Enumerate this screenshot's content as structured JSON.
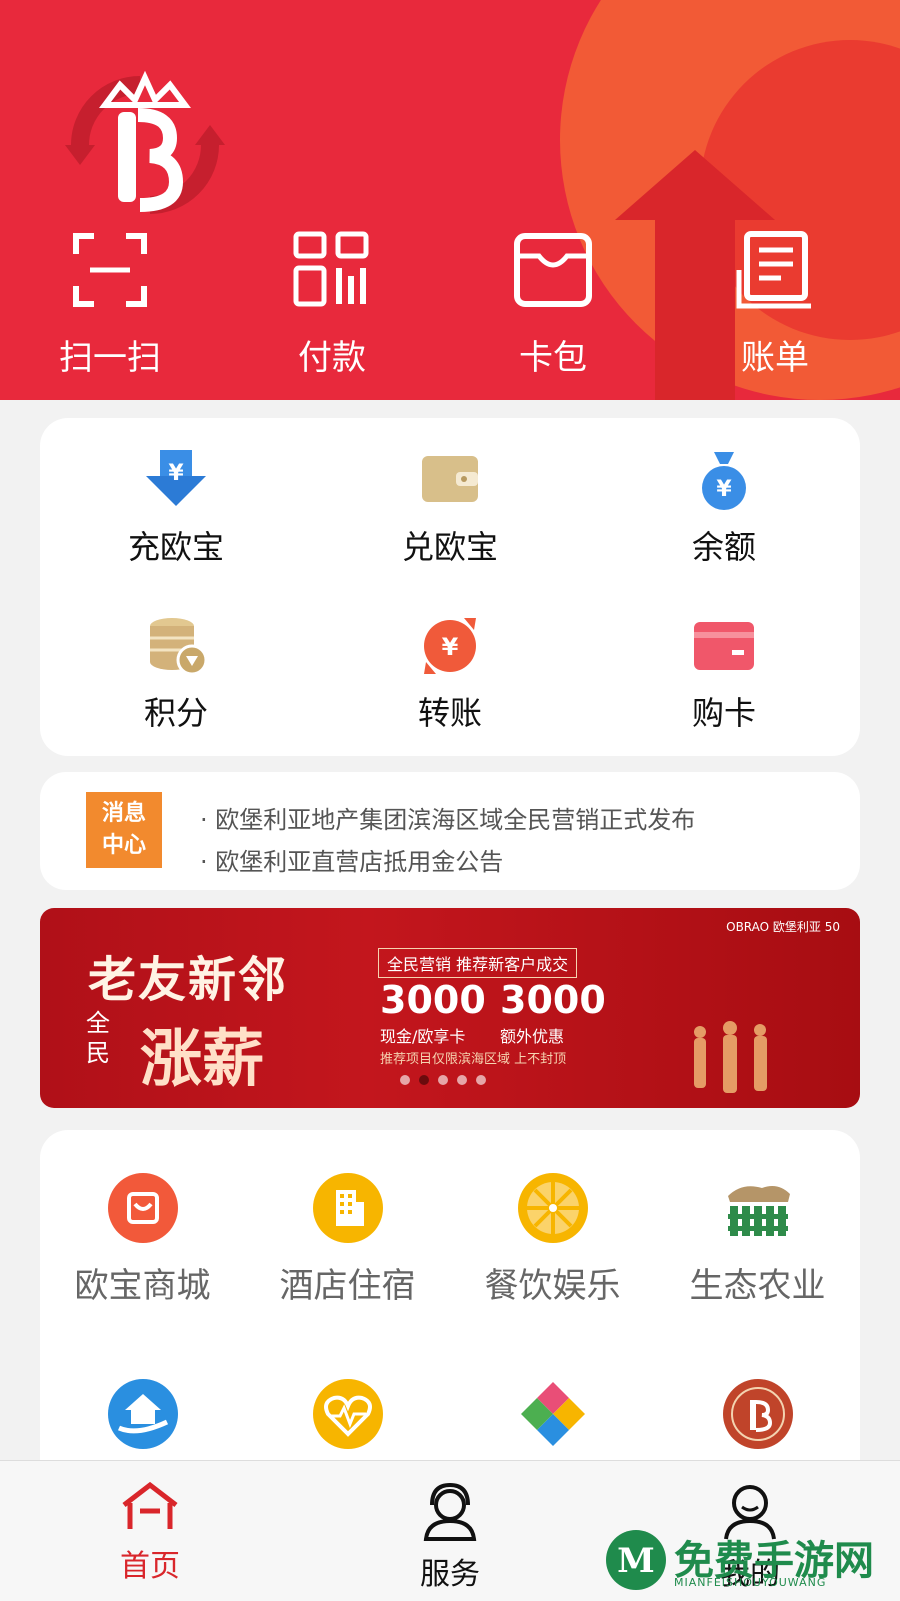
{
  "header": {
    "quick_actions": [
      {
        "label": "扫一扫",
        "icon": "scan-icon"
      },
      {
        "label": "付款",
        "icon": "payment-code-icon"
      },
      {
        "label": "卡包",
        "icon": "card-wallet-icon"
      },
      {
        "label": "账单",
        "icon": "bill-icon"
      }
    ]
  },
  "finance": {
    "items": [
      {
        "label": "充欧宝",
        "icon": "recharge-icon"
      },
      {
        "label": "兑欧宝",
        "icon": "wallet-icon"
      },
      {
        "label": "余额",
        "icon": "money-bag-icon"
      },
      {
        "label": "积分",
        "icon": "coins-icon"
      },
      {
        "label": "转账",
        "icon": "transfer-icon"
      },
      {
        "label": "购卡",
        "icon": "card-icon"
      }
    ]
  },
  "news": {
    "badge": "消息\n中心",
    "items": [
      "· 欧堡利亚地产集团滨海区域全民营销正式发布",
      "· 欧堡利亚直营店抵用金公告"
    ]
  },
  "banner": {
    "title1": "老友新邻",
    "prefix": "全民",
    "title2": "涨薪",
    "tag": "全民营销 推荐新客户成交",
    "num1": "3000",
    "num2": "3000",
    "sub1": "现金/欧享卡",
    "sub2": "额外优惠",
    "note": "推荐项目仅限滨海区域 上不封顶",
    "brand": "OBRAO 欧堡利亚 50",
    "dots": 5,
    "active_dot": 1
  },
  "services": {
    "items": [
      {
        "label": "欧宝商城",
        "icon": "shopping-bag-icon",
        "color": "#f2593a"
      },
      {
        "label": "酒店住宿",
        "icon": "hotel-icon",
        "color": "#f7b500"
      },
      {
        "label": "餐饮娱乐",
        "icon": "orange-slice-icon",
        "color": "#f7b500"
      },
      {
        "label": "生态农业",
        "icon": "farm-icon",
        "color": "#2e8b4a"
      },
      {
        "label": "",
        "icon": "home-care-icon",
        "color": "#2a8fe0"
      },
      {
        "label": "",
        "icon": "heart-pulse-icon",
        "color": "#f7b500"
      },
      {
        "label": "",
        "icon": "puzzle-hands-icon",
        "color": "#e94e77"
      },
      {
        "label": "",
        "icon": "brand-seal-icon",
        "color": "#c0442a"
      }
    ]
  },
  "tabbar": {
    "tabs": [
      {
        "label": "首页",
        "icon": "home-icon",
        "active": true
      },
      {
        "label": "服务",
        "icon": "service-icon",
        "active": false
      },
      {
        "label": "我的",
        "icon": "profile-icon",
        "active": false
      }
    ],
    "active_color": "#d9262b"
  },
  "watermark": {
    "text": "免费手游网",
    "sub": "MIANFEISHOUYOUWANG"
  }
}
